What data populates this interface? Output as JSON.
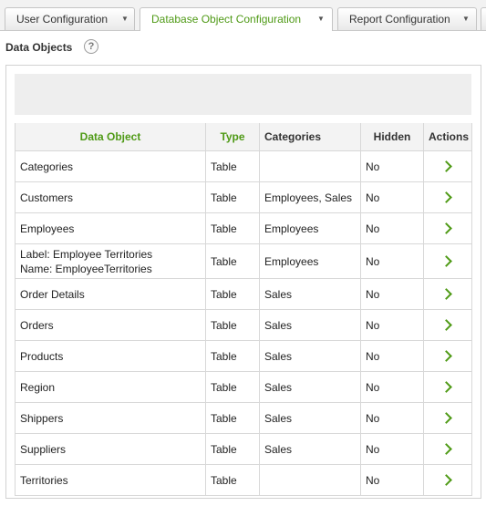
{
  "tabs": [
    {
      "label": "User Configuration",
      "active": false
    },
    {
      "label": "Database Object Configuration",
      "active": true
    },
    {
      "label": "Report Configuration",
      "active": false
    }
  ],
  "section": {
    "title": "Data Objects",
    "help": "?"
  },
  "table": {
    "headers": {
      "data_object": "Data Object",
      "type": "Type",
      "categories": "Categories",
      "hidden": "Hidden",
      "actions": "Actions"
    },
    "rows": [
      {
        "name": "Categories",
        "type": "Table",
        "categories": "",
        "hidden": "No"
      },
      {
        "name": "Customers",
        "type": "Table",
        "categories": "Employees, Sales",
        "hidden": "No"
      },
      {
        "name": "Employees",
        "type": "Table",
        "categories": "Employees",
        "hidden": "No"
      },
      {
        "name_label": "Label: Employee Territories",
        "name_name": "Name: EmployeeTerritories",
        "type": "Table",
        "categories": "Employees",
        "hidden": "No"
      },
      {
        "name": "Order Details",
        "type": "Table",
        "categories": "Sales",
        "hidden": "No"
      },
      {
        "name": "Orders",
        "type": "Table",
        "categories": "Sales",
        "hidden": "No"
      },
      {
        "name": "Products",
        "type": "Table",
        "categories": "Sales",
        "hidden": "No"
      },
      {
        "name": "Region",
        "type": "Table",
        "categories": "Sales",
        "hidden": "No"
      },
      {
        "name": "Shippers",
        "type": "Table",
        "categories": "Sales",
        "hidden": "No"
      },
      {
        "name": "Suppliers",
        "type": "Table",
        "categories": "Sales",
        "hidden": "No"
      },
      {
        "name": "Territories",
        "type": "Table",
        "categories": "",
        "hidden": "No"
      }
    ]
  },
  "colors": {
    "accent": "#4f9a16"
  }
}
